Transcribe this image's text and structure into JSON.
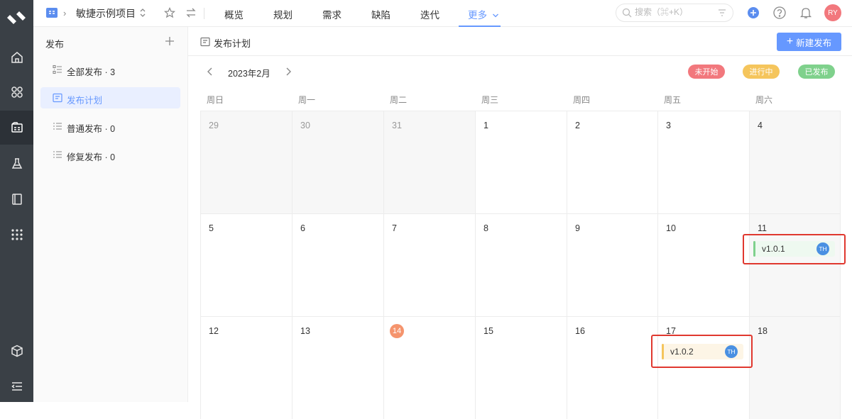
{
  "topbar": {
    "project_name": "敏捷示例项目",
    "nav": [
      "概览",
      "规划",
      "需求",
      "缺陷",
      "迭代",
      "更多"
    ],
    "active_nav": "更多",
    "search_placeholder": "搜索（⌘+K）",
    "avatar_initials": "RY"
  },
  "rail": {
    "icons": [
      "logo-icon",
      "home-icon",
      "apps-icon",
      "release-icon",
      "test-flask-icon",
      "book-icon",
      "grid-icon",
      "cube-icon",
      "collapse-icon"
    ],
    "active": "release-icon"
  },
  "sidebar": {
    "title": "发布",
    "items": [
      {
        "label": "全部发布 · 3",
        "icon": "list-icon"
      },
      {
        "label": "发布计划",
        "icon": "plan-icon",
        "active": true
      },
      {
        "label": "普通发布 · 0",
        "icon": "list-lines-icon"
      },
      {
        "label": "修复发布 · 0",
        "icon": "list-lines-icon"
      }
    ]
  },
  "main": {
    "title": "发布计划",
    "new_button": "新建发布"
  },
  "calendar": {
    "month_label": "2023年2月",
    "legend": [
      {
        "label": "未开始",
        "color": "#f2787d"
      },
      {
        "label": "进行中",
        "color": "#f5c55c"
      },
      {
        "label": "已发布",
        "color": "#7fd18c"
      }
    ],
    "weekdays": [
      "周日",
      "周一",
      "周二",
      "周三",
      "周四",
      "周五",
      "周六"
    ],
    "weeks": [
      [
        "29",
        "30",
        "31",
        "1",
        "2",
        "3",
        "4"
      ],
      [
        "5",
        "6",
        "7",
        "8",
        "9",
        "10",
        "11"
      ],
      [
        "12",
        "13",
        "14",
        "15",
        "16",
        "17",
        "18"
      ]
    ],
    "today": "14",
    "releases": [
      {
        "name": "v1.0.1",
        "owner": "TH",
        "status": "已发布",
        "bar_color": "#7fd18c",
        "bg": "#eef9f0",
        "day": "11"
      },
      {
        "name": "v1.0.2",
        "owner": "TH",
        "status": "进行中",
        "bar_color": "#f5c55c",
        "bg": "#fdf5e6",
        "day": "17"
      }
    ]
  }
}
